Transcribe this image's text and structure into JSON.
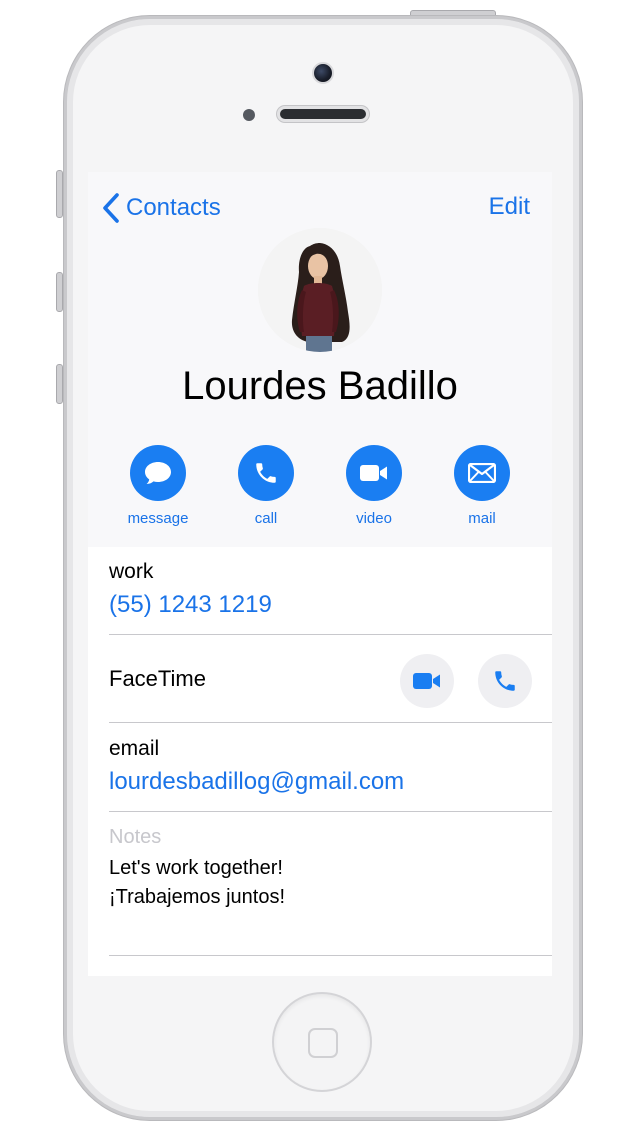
{
  "nav": {
    "back_label": "Contacts",
    "edit_label": "Edit"
  },
  "contact": {
    "name": "Lourdes Badillo"
  },
  "actions": [
    {
      "label": "message",
      "icon": "message-bubble-icon"
    },
    {
      "label": "call",
      "icon": "phone-icon"
    },
    {
      "label": "video",
      "icon": "video-camera-icon"
    },
    {
      "label": "mail",
      "icon": "envelope-icon"
    }
  ],
  "phone": {
    "label": "work",
    "value": "(55) 1243 1219"
  },
  "facetime": {
    "label": "FaceTime"
  },
  "email": {
    "label": "email",
    "value": "lourdesbadillog@gmail.com"
  },
  "notes": {
    "label": "Notes",
    "lines": [
      "Let's work together!",
      "¡Trabajemos juntos!"
    ]
  },
  "colors": {
    "accent": "#1a73e8",
    "action_fill": "#1a7ef2",
    "header_bg": "#f8f8fa",
    "divider": "#c8c8cc"
  }
}
